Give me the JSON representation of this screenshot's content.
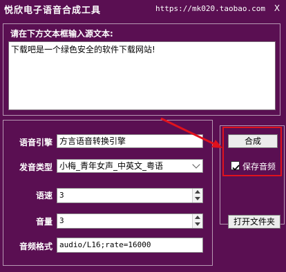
{
  "header": {
    "app_title": "悦欣电子语音合成工具",
    "site_url": "https://mk020.taobao.com",
    "close_label": "X"
  },
  "source": {
    "label": "请在下方文本框输入源文本:",
    "text": "下载吧是一个绿色安全的软件下载网站!"
  },
  "settings": {
    "engine_label": "语音引擎",
    "engine_value": "方言语音转换引擎",
    "voice_label": "发音类型",
    "voice_value": "小梅_青年女声_中英文_粤语",
    "speed_label": "语速",
    "speed_value": "3",
    "volume_label": "音量",
    "volume_value": "3",
    "format_label": "音频格式",
    "format_value": "audio/L16;rate=16000"
  },
  "actions": {
    "synth_label": "合成",
    "save_audio_label": "保存音频",
    "save_audio_checked": true,
    "open_folder_label": "打开文件夹"
  },
  "colors": {
    "background": "#5a0f52",
    "highlight": "#e0121d"
  }
}
